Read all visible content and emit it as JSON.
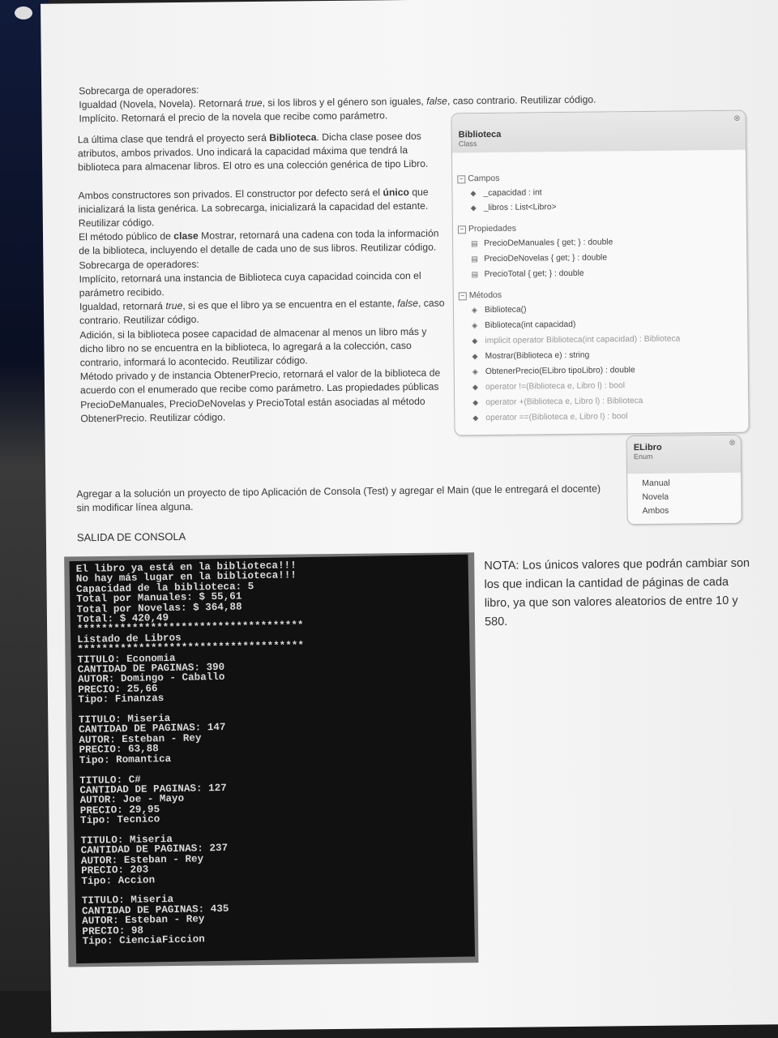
{
  "intro": {
    "line1": "Sobrecarga de operadores:",
    "line2a": "Igualdad (Novela, Novela). Retornará ",
    "line2b": "true",
    "line2c": ", si los libros y el género son iguales, ",
    "line2d": "false",
    "line2e": ", caso contrario. Reutilizar código.",
    "line3": "Implícito. Retornará el precio de la novela que recibe como parámetro."
  },
  "body": {
    "p1a": "La última clase que tendrá el proyecto será ",
    "p1b": "Biblioteca",
    "p1c": ". Dicha clase posee dos atributos, ambos privados. Uno indicará la capacidad máxima que tendrá la biblioteca para almacenar libros. El otro es una colección genérica de tipo Libro.",
    "p2a": "Ambos constructores son privados. El constructor por defecto será el ",
    "p2b": "único",
    "p2c": " que inicializará la lista genérica. La sobrecarga, inicializará la capacidad del estante. Reutilizar código.",
    "p3a": "El método público de ",
    "p3b": "clase",
    "p3c": " Mostrar, retornará una cadena con toda la información de la biblioteca, incluyendo el detalle de cada uno de sus libros. Reutilizar código.",
    "p4": "Sobrecarga de operadores:",
    "p5": "Implícito, retornará una instancia de Biblioteca cuya capacidad coincida con el parámetro recibido.",
    "p6a": "Igualdad, retornará ",
    "p6b": "true",
    "p6c": ", si es que el libro ya se encuentra en el estante, ",
    "p6d": "false",
    "p6e": ", caso contrario. Reutilizar código.",
    "p7": "Adición, si la biblioteca posee capacidad de almacenar al menos un libro más y dicho libro no se encuentra en la biblioteca, lo agregará a la colección, caso contrario, informará lo acontecido. Reutilizar código.",
    "p8": "Método privado y de instancia ObtenerPrecio, retornará el valor de la biblioteca de acuerdo con el enumerado que recibe como parámetro. Las propiedades públicas PrecioDeManuales, PrecioDeNovelas y PrecioTotal están asociadas al método ObtenerPrecio. Reutilizar código."
  },
  "lead": "Agregar a la solución un proyecto de tipo Aplicación de Consola (Test) y agregar el Main (que le entregará el docente) sin modificar línea alguna.",
  "section_title": "SALIDA DE CONSOLA",
  "note": "NOTA: Los únicos valores que podrán cambiar son los que indican la cantidad de páginas de cada libro, ya que son valores aleatorios de entre 10 y 580.",
  "class_diagram": {
    "name": "Biblioteca",
    "kind": "Class",
    "collapse": "⊗",
    "groups": {
      "campos": "Campos",
      "propiedades": "Propiedades",
      "metodos": "Métodos"
    },
    "fields": [
      "_capacidad : int",
      "_libros : List<Libro>"
    ],
    "properties": [
      "PrecioDeManuales { get; } : double",
      "PrecioDeNovelas { get; } : double",
      "PrecioTotal { get; } : double"
    ],
    "methods": [
      "Biblioteca()",
      "Biblioteca(int capacidad)",
      "implicit operator Biblioteca(int capacidad) : Biblioteca",
      "Mostrar(Biblioteca e) : string",
      "ObtenerPrecio(ELibro tipoLibro) : double",
      "operator !=(Biblioteca e, Libro l) : bool",
      "operator +(Biblioteca e, Libro l) : Biblioteca",
      "operator ==(Biblioteca e, Libro l) : bool"
    ]
  },
  "enum_diagram": {
    "name": "ELibro",
    "kind": "Enum",
    "collapse": "⊗",
    "values": [
      "Manual",
      "Novela",
      "Ambos"
    ]
  },
  "console": {
    "lines": [
      "El libro ya está en la biblioteca!!!",
      "No hay más lugar en la biblioteca!!!",
      "Capacidad de la biblioteca: 5",
      "Total por Manuales: $ 55,61",
      "Total por Novelas: $ 364,88",
      "Total: $ 420,49",
      "*************************************",
      "Listado de Libros",
      "*************************************",
      "TITULO: Economia",
      "CANTIDAD DE PAGINAS: 390",
      "AUTOR: Domingo - Caballo",
      "PRECIO: 25,66",
      "Tipo: Finanzas",
      "",
      "TITULO: Miseria",
      "CANTIDAD DE PAGINAS: 147",
      "AUTOR: Esteban - Rey",
      "PRECIO: 63,88",
      "Tipo: Romantica",
      "",
      "TITULO: C#",
      "CANTIDAD DE PAGINAS: 127",
      "AUTOR: Joe - Mayo",
      "PRECIO: 29,95",
      "Tipo: Tecnico",
      "",
      "TITULO: Miseria",
      "CANTIDAD DE PAGINAS: 237",
      "AUTOR: Esteban - Rey",
      "PRECIO: 203",
      "Tipo: Accion",
      "",
      "TITULO: Miseria",
      "CANTIDAD DE PAGINAS: 435",
      "AUTOR: Esteban - Rey",
      "PRECIO: 98",
      "Tipo: CienciaFiccion"
    ]
  }
}
